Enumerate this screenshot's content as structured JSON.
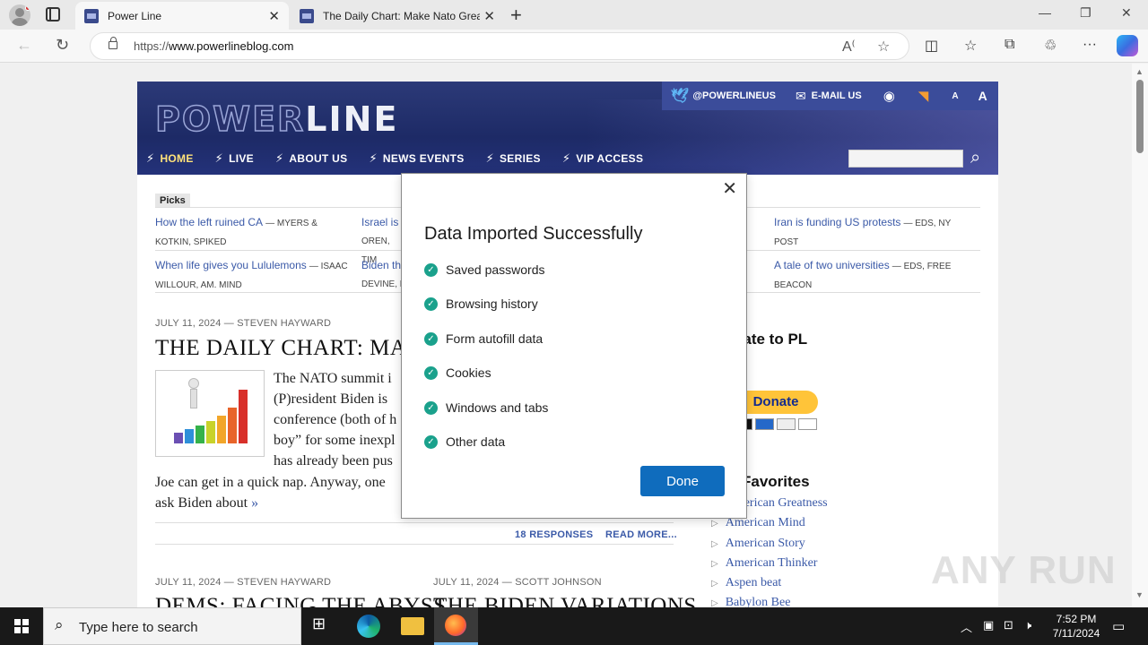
{
  "browser": {
    "tabs": [
      {
        "title": "Power Line",
        "active": true
      },
      {
        "title": "The Daily Chart: Make Nato Great Again",
        "active": false
      }
    ],
    "new_tab_icon": "plus-icon",
    "address": {
      "prefix": "https://",
      "host": "www.powerlineblog.com"
    }
  },
  "site": {
    "logo_part1": "POWER",
    "logo_part2": "LINE",
    "social": {
      "twitter": "@POWERLINEUS",
      "email": "E-MAIL US",
      "font_small": "A",
      "font_large": "A"
    },
    "nav": [
      "HOME",
      "LIVE",
      "ABOUT US",
      "NEWS EVENTS",
      "SERIES",
      "VIP ACCESS"
    ],
    "picks_label": "Picks",
    "picks": [
      {
        "title": "How the left ruined CA",
        "source": "MYERS & KOTKIN, SPIKED"
      },
      {
        "title": "Israel is",
        "source": "OREN, TIM"
      },
      {
        "title": "Iran is funding US protests",
        "source": "EDS, NY POST"
      },
      {
        "title": "When life gives you Lululemons",
        "source": "ISAAC WILLOUR, AM. MIND"
      },
      {
        "title": "Biden th",
        "source": "DEVINE, N"
      },
      {
        "title": "A tale of two universities",
        "source": "EDS, FREE BEACON"
      }
    ],
    "post1": {
      "meta": "JULY 11, 2024 — STEVEN HAYWARD",
      "headline": "THE DAILY CHART: MA",
      "lines": [
        "The NATO summit i",
        "(P)resident Biden is",
        "conference (both of h",
        "boy” for some inexpl",
        "has already been pus"
      ],
      "tail": "Joe can get in a quick nap. Anyway, one",
      "tail2": "ask Biden about",
      "tail_link": "»",
      "responses": "18 RESPONSES",
      "read_more": "READ MORE..."
    },
    "post2": {
      "meta": "JULY 11, 2024 — STEVEN HAYWARD",
      "headline": "DEMS: FACING THE ABYSS"
    },
    "post3": {
      "meta": "JULY 11, 2024 — SCOTT JOHNSON",
      "headline": "THE BIDEN VARIATIONS"
    },
    "sidebar": {
      "donate_title": "nate to PL",
      "donate_button": "Donate",
      "favorites_title": "Favorites",
      "favorites": [
        "American Greatness",
        "American Mind",
        "American Story",
        "American Thinker",
        "Aspen beat",
        "Babylon Bee"
      ]
    }
  },
  "dialog": {
    "title": "Data Imported Successfully",
    "items": [
      "Saved passwords",
      "Browsing history",
      "Form autofill data",
      "Cookies",
      "Windows and tabs",
      "Other data"
    ],
    "done": "Done",
    "accent": "#0f6cbd",
    "check_color": "#1aa18c"
  },
  "watermark": "ANY RUN",
  "taskbar": {
    "search_placeholder": "Type here to search",
    "time": "7:52 PM",
    "date": "7/11/2024"
  }
}
